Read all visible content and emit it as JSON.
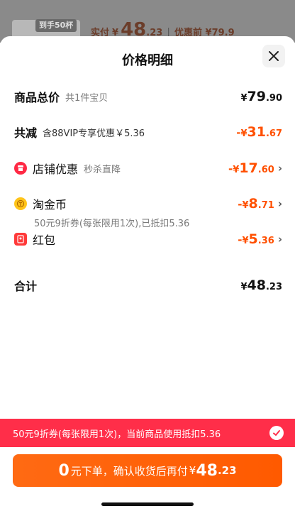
{
  "background": {
    "thumb_badge": "到手50杯",
    "paid_label": "实付",
    "paid_currency": "¥",
    "paid_int": "48",
    "paid_dec": ".23",
    "before_discount": "优惠前 ¥79.9"
  },
  "sheet": {
    "title": "价格明细"
  },
  "rows": {
    "total": {
      "label": "商品总价",
      "sub": "共1件宝贝",
      "currency": "¥",
      "int": "79",
      "dec": ".90"
    },
    "reduction": {
      "label": "共减",
      "sub": "含88VIP专享优惠￥5.36",
      "sign": "-",
      "currency": "¥",
      "int": "31",
      "dec": ".67"
    },
    "shop_discount": {
      "label": "店铺优惠",
      "sub": "秒杀直降",
      "sign": "-",
      "currency": "¥",
      "int": "17",
      "dec": ".60"
    },
    "taojinbi": {
      "label": "淘金币",
      "sign": "-",
      "currency": "¥",
      "int": "8",
      "dec": ".71"
    },
    "red_packet": {
      "label": "红包",
      "sign": "-",
      "currency": "¥",
      "int": "5",
      "dec": ".36",
      "note": "50元9折券(每张限用1次),已抵扣5.36"
    },
    "sum": {
      "label": "合计",
      "currency": "¥",
      "int": "48",
      "dec": ".23"
    }
  },
  "coupon_bar": {
    "text": "50元9折券(每张限用1次)，当前商品使用抵扣5.36"
  },
  "pay_button": {
    "zero": "0",
    "text": "元下单，确认收货后再付",
    "currency": "¥",
    "int": "48",
    "dec": ".23"
  },
  "colors": {
    "accent": "#ff5000",
    "coupon_red": "#ff2e49"
  }
}
